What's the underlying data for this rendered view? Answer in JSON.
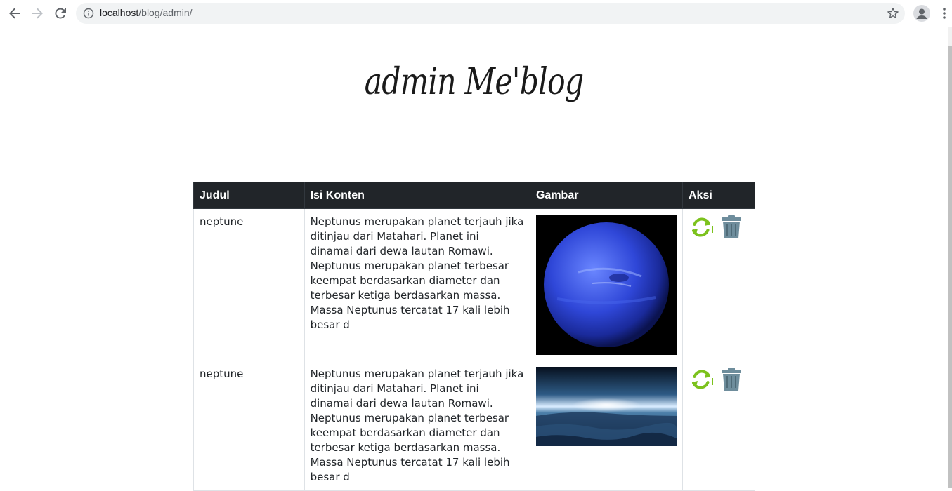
{
  "browser": {
    "url_host": "localhost",
    "url_path": "/blog/admin/"
  },
  "page": {
    "title": "admin Me'blog"
  },
  "table": {
    "headers": [
      "Judul",
      "Isi Konten",
      "Gambar",
      "Aksi"
    ],
    "rows": [
      {
        "judul": "neptune",
        "isi": "Neptunus merupakan planet terjauh jika ditinjau dari Matahari. Planet ini dinamai dari dewa lautan Romawi. Neptunus merupakan planet terbesar keempat berdasarkan diameter dan terbesar ketiga berdasarkan massa. Massa Neptunus tercatat 17 kali lebih besar d",
        "image": "neptune-planet-image"
      },
      {
        "judul": "neptune",
        "isi": "Neptunus merupakan planet terjauh jika ditinjau dari Matahari. Planet ini dinamai dari dewa lautan Romawi. Neptunus merupakan planet terbesar keempat berdasarkan diameter dan terbesar ketiga berdasarkan massa. Massa Neptunus tercatat 17 kali lebih besar d",
        "image": "neptune-surface-image"
      }
    ]
  },
  "icons": {
    "back": "arrow-left-icon",
    "forward": "arrow-right-icon",
    "reload": "reload-icon",
    "info": "info-icon",
    "star": "star-icon",
    "profile": "profile-icon",
    "menu": "kebab-menu-icon",
    "update": "refresh-icon",
    "delete": "trash-icon"
  },
  "colors": {
    "header_bg": "#212529",
    "update_icon": "#7cc21d",
    "delete_icon": "#6e8d9c"
  }
}
